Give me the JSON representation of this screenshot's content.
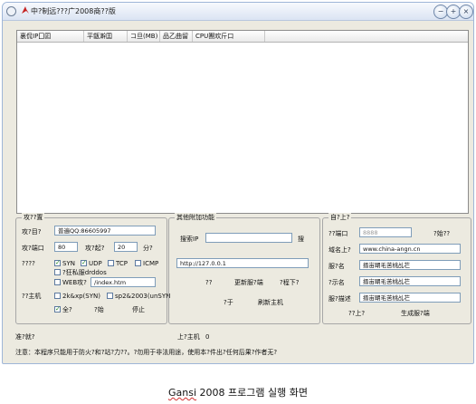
{
  "window": {
    "title": "中?制远???广2008商??版"
  },
  "window_buttons": {
    "minimize": "−",
    "restore": "+",
    "close": "×"
  },
  "list": {
    "columns": [
      "裏侃IP囗囸",
      "平甑澣囯",
      "コ旦(MB)",
      "品乙曲留",
      "CPU團欢斤口"
    ]
  },
  "attack": {
    "label": "攻??置",
    "target_label": "攻?目?",
    "target_value": "普遍QQ:86605997",
    "port_label": "攻?端口",
    "port_value": "80",
    "threads_label": "攻?起?",
    "threads_value": "20",
    "minutes_unit": "分?",
    "mode_label": "????",
    "syn": "SYN",
    "udp": "UDP",
    "tcp": "TCP",
    "icmp": "ICMP",
    "drddos": "?狂私服drddos",
    "web_label": "WEB攻?",
    "web_value": "/index.htm",
    "host_label": "??主机",
    "os1": "2k&xp(SYN)",
    "os2": "sp2&2003(unSYN",
    "all_label": "全?",
    "start": "?始",
    "stop": "停止"
  },
  "extra": {
    "label": "其他附加功能",
    "search_ip_label": "搜索IP",
    "search_button": "搜",
    "url_value": "http://127.0.0.1",
    "q": "??",
    "update_server": "更新服?端",
    "next": "?程下?",
    "about": "?于",
    "refresh_hosts": "刷新主机"
  },
  "self": {
    "label": "自?上?",
    "port_label": "??端口",
    "port_value": "8888",
    "gen_label": "?始??",
    "domain_label": "域名上?",
    "domain_value": "www.china-angn.cn",
    "service_label": "服?名",
    "service_value": "搢峀朙毛苦桃乩芢",
    "display_label": "?示名",
    "display_value": "搢峀朙毛苦桃乩芢",
    "desc_label": "服?描述",
    "desc_value": "搢峀朙毛苦桃乩芢",
    "upload": "??上?",
    "gen_server": "生成服?端"
  },
  "status": {
    "ready": "准?就?",
    "online_label": "上?主机",
    "online_count": "0"
  },
  "note": "注意：本程序只能用于防火?和?站?力??。?勿用于非法用途，使用本?件出?任何后果?作者无?",
  "caption": {
    "underlined": "Gansi",
    "rest": " 2008 프로그램 실행 화면"
  }
}
